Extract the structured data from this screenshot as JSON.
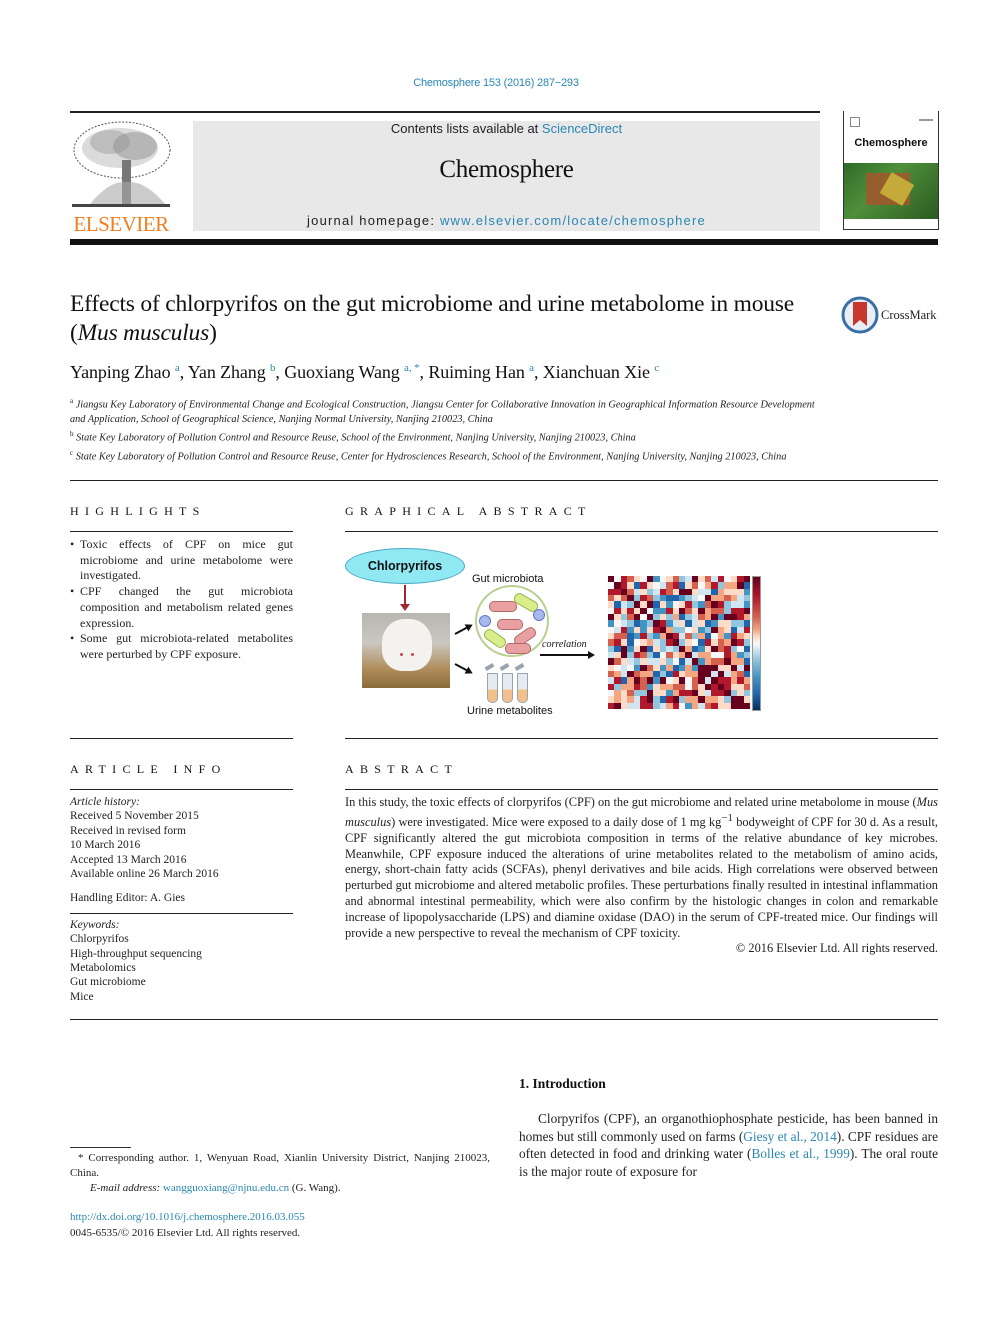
{
  "header": {
    "citation": "Chemosphere 153 (2016) 287−293",
    "publisher_logo_text": "ELSEVIER",
    "contents_prefix": "Contents lists available at ",
    "contents_link": "ScienceDirect",
    "journal_name": "Chemosphere",
    "homepage_prefix": "journal homepage: ",
    "homepage_link": "www.elsevier.com/locate/chemosphere",
    "cover_title": "Chemosphere"
  },
  "article": {
    "title_part1": "Effects of chlorpyrifos on the gut microbiome and urine metabolome in mouse (",
    "title_italic": "Mus musculus",
    "title_part2": ")",
    "crossmark_label": "CrossMark",
    "authors": [
      {
        "name": "Yanping Zhao",
        "sup": "a"
      },
      {
        "name": "Yan Zhang",
        "sup": "b"
      },
      {
        "name": "Guoxiang Wang",
        "sup": "a, *"
      },
      {
        "name": "Ruiming Han",
        "sup": "a"
      },
      {
        "name": "Xianchuan Xie",
        "sup": "c"
      }
    ],
    "affiliations": [
      {
        "sup": "a",
        "text": "Jiangsu Key Laboratory of Environmental Change and Ecological Construction, Jiangsu Center for Collaborative Innovation in Geographical Information Resource Development and Application, School of Geographical Science, Nanjing Normal University, Nanjing 210023, China"
      },
      {
        "sup": "b",
        "text": "State Key Laboratory of Pollution Control and Resource Reuse, School of the Environment, Nanjing University, Nanjing 210023, China"
      },
      {
        "sup": "c",
        "text": "State Key Laboratory of Pollution Control and Resource Reuse, Center for Hydrosciences Research, School of the Environment, Nanjing University, Nanjing 210023, China"
      }
    ]
  },
  "highlights": {
    "heading": "HIGHLIGHTS",
    "items": [
      "Toxic effects of CPF on mice gut microbiome and urine metabolome were investigated.",
      "CPF changed the gut microbiota composition and metabolism related genes expression.",
      "Some gut microbiota-related metabolites were perturbed by CPF exposure."
    ]
  },
  "graphical_abstract": {
    "heading": "GRAPHICAL ABSTRACT",
    "oval_label": "Chlorpyrifos",
    "gut_label": "Gut microbiota",
    "urine_label": "Urine metabolites",
    "arrow_label": "correlation",
    "colors": {
      "oval_fill": "#8fe8f2",
      "arrow_red": "#a1282e",
      "rod_red": "#e8a0a0",
      "rod_green": "#d8ee8a",
      "coccus": "#a8b8ef"
    }
  },
  "article_info": {
    "heading": "ARTICLE INFO",
    "history_label": "Article history:",
    "history": [
      "Received 5 November 2015",
      "Received in revised form",
      "10 March 2016",
      "Accepted 13 March 2016",
      "Available online 26 March 2016"
    ],
    "editor": "Handling Editor: A. Gies",
    "keywords_label": "Keywords:",
    "keywords": [
      "Chlorpyrifos",
      "High-throughput sequencing",
      "Metabolomics",
      "Gut microbiome",
      "Mice"
    ]
  },
  "abstract": {
    "heading": "ABSTRACT",
    "text_1": "In this study, the toxic effects of clorpyrifos (CPF) on the gut microbiome and related urine metabolome in mouse (",
    "text_italic": "Mus musculus",
    "text_2": ") were investigated. Mice were exposed to a daily dose of 1 mg kg",
    "text_sup": "−1",
    "text_3": " bodyweight of CPF for 30 d. As a result, CPF significantly altered the gut microbiota composition in terms of the relative abundance of key microbes. Meanwhile, CPF exposure induced the alterations of urine metabolites related to the metabolism of amino acids, energy, short-chain fatty acids (SCFAs), phenyl derivatives and bile acids. High correlations were observed between perturbed gut microbiome and altered metabolic profiles. These perturbations finally resulted in intestinal inflammation and abnormal intestinal permeability, which were also confirm by the histologic changes in colon and remarkable increase of lipopolysaccharide (LPS) and diamine oxidase (DAO) in the serum of CPF-treated mice. Our findings will provide a new perspective to reveal the mechanism of CPF toxicity.",
    "copyright": "© 2016 Elsevier Ltd. All rights reserved."
  },
  "introduction": {
    "heading": "1.  Introduction",
    "text_1": "Clorpyrifos (CPF), an organothiophosphate pesticide, has been banned in homes but still commonly used on farms (",
    "ref_1": "Giesy et al., 2014",
    "text_2": "). CPF residues are often detected in food and drinking water (",
    "ref_2": "Bolles et al., 1999",
    "text_3": "). The oral route is the major route of exposure for"
  },
  "footnote": {
    "corresponding": "* Corresponding author. 1, Wenyuan Road, Xianlin University District, Nanjing 210023, China.",
    "email_label": "E-mail address: ",
    "email": "wangguoxiang@njnu.edu.cn",
    "email_suffix": " (G. Wang).",
    "doi": "http://dx.doi.org/10.1016/j.chemosphere.2016.03.055",
    "issn": "0045-6535/© 2016 Elsevier Ltd. All rights reserved."
  },
  "theme": {
    "link_color": "#2a87b4",
    "elsevier_orange": "#f07f1f",
    "masthead_bg": "#e8e8e8"
  }
}
